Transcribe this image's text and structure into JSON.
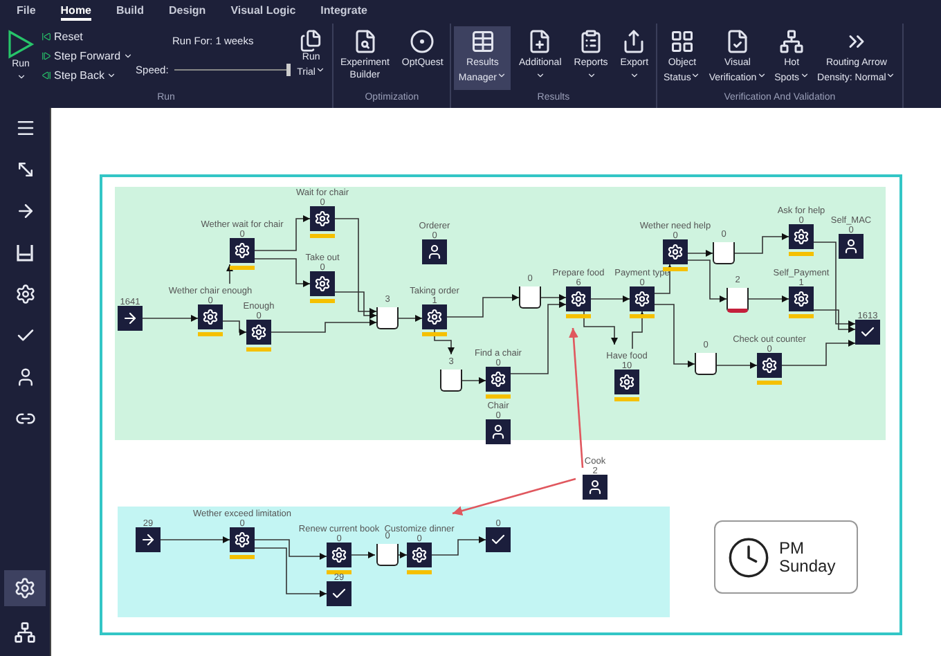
{
  "menu": [
    {
      "label": "File",
      "selected": false
    },
    {
      "label": "Home",
      "selected": true
    },
    {
      "label": "Build",
      "selected": false
    },
    {
      "label": "Design",
      "selected": false
    },
    {
      "label": "Visual Logic",
      "selected": false
    },
    {
      "label": "Integrate",
      "selected": false
    }
  ],
  "ribbon": {
    "run": {
      "label": "Run",
      "run_button": {
        "label": "Run",
        "dropdown": true
      },
      "steps": [
        {
          "label": "Reset",
          "dropdown": false
        },
        {
          "label": "Step Forward",
          "dropdown": true
        },
        {
          "label": "Step Back",
          "dropdown": true
        }
      ],
      "run_for": "Run For: 1 weeks",
      "speed_label": "Speed:",
      "speed": {
        "level": 1
      },
      "run_trial": {
        "lines": [
          "Run",
          "Trial"
        ],
        "dropdown": true
      }
    },
    "groups": [
      {
        "label": "Optimization",
        "buttons": [
          {
            "lines": [
              "Experiment",
              "Builder"
            ],
            "dropdown": false,
            "selected": false
          },
          {
            "lines": [
              "OptQuest"
            ],
            "dropdown": false,
            "selected": false
          }
        ]
      },
      {
        "label": "Results",
        "buttons": [
          {
            "lines": [
              "Results",
              "Manager"
            ],
            "dropdown": true,
            "selected": true
          },
          {
            "lines": [
              "Additional"
            ],
            "dropdown": true,
            "selected": false
          },
          {
            "lines": [
              "Reports"
            ],
            "dropdown": true,
            "selected": false
          },
          {
            "lines": [
              "Export"
            ],
            "dropdown": true,
            "selected": false
          }
        ]
      },
      {
        "label": "Verification And Validation",
        "buttons": [
          {
            "lines": [
              "Object",
              "Status"
            ],
            "dropdown": true,
            "selected": false
          },
          {
            "lines": [
              "Visual",
              "Verification"
            ],
            "dropdown": true,
            "selected": false
          },
          {
            "lines": [
              "Hot",
              "Spots"
            ],
            "dropdown": true,
            "selected": false
          },
          {
            "lines": [
              "Routing Arrow",
              "Density: Normal"
            ],
            "dropdown": true,
            "selected": false
          }
        ]
      }
    ]
  },
  "sidebar": {
    "tools": [
      {
        "selected": false
      },
      {
        "selected": false
      },
      {
        "selected": false
      },
      {
        "selected": false
      },
      {
        "selected": false
      },
      {
        "selected": false
      },
      {
        "selected": false
      },
      {
        "selected": false
      }
    ],
    "bottom_tools": [
      {
        "selected": true
      },
      {
        "selected": false
      }
    ]
  },
  "nodes": [
    {
      "kind": "arrival",
      "count": "1641"
    },
    {
      "kind": "activity",
      "label": "Wether chair enough",
      "count": "0"
    },
    {
      "kind": "activity",
      "label": "Wether wait for chair",
      "count": "0"
    },
    {
      "kind": "activity",
      "label": "Wait for chair",
      "count": "0"
    },
    {
      "kind": "activity",
      "label": "Take out",
      "count": "0"
    },
    {
      "kind": "activity",
      "label": "Enough",
      "count": "0"
    },
    {
      "kind": "storage",
      "count": "3",
      "alert": false
    },
    {
      "kind": "resource",
      "label": "Orderer",
      "count": "0"
    },
    {
      "kind": "activity",
      "label": "Taking order",
      "count": "1"
    },
    {
      "kind": "storage",
      "count": "3",
      "alert": false
    },
    {
      "kind": "activity",
      "label": "Find a chair",
      "count": "0"
    },
    {
      "kind": "resource",
      "label": "Chair",
      "count": "0"
    },
    {
      "kind": "storage",
      "count": "0",
      "alert": false
    },
    {
      "kind": "activity",
      "label": "Prepare food",
      "count": "6"
    },
    {
      "kind": "activity",
      "label": "Payment type",
      "count": "0"
    },
    {
      "kind": "activity",
      "label": "Have food",
      "count": "10"
    },
    {
      "kind": "activity",
      "label": "Wether need help",
      "count": "0"
    },
    {
      "kind": "storage",
      "count": "0",
      "alert": false
    },
    {
      "kind": "storage",
      "count": "2",
      "alert": true
    },
    {
      "kind": "activity",
      "label": "Ask for help",
      "count": "0"
    },
    {
      "kind": "resource",
      "label": "Self_MAC",
      "count": "0"
    },
    {
      "kind": "activity",
      "label": "Self_Payment",
      "count": "1"
    },
    {
      "kind": "storage",
      "count": "0",
      "alert": false
    },
    {
      "kind": "activity",
      "label": "Check out counter",
      "count": "0"
    },
    {
      "kind": "exit",
      "count": "1613"
    },
    {
      "kind": "resource",
      "label": "Cook",
      "count": "2"
    },
    {
      "kind": "arrival",
      "count": "29"
    },
    {
      "kind": "activity",
      "label": "Wether exceed limitation",
      "count": "0"
    },
    {
      "kind": "activity",
      "label": "Renew current book",
      "count": "0"
    },
    {
      "kind": "exit",
      "count": "29"
    },
    {
      "kind": "storage",
      "count": "0",
      "alert": false
    },
    {
      "kind": "activity",
      "label": "Customize dinner",
      "count": "0"
    },
    {
      "kind": "exit",
      "count": "0"
    }
  ],
  "clock": {
    "period": "PM",
    "day": "Sunday"
  }
}
